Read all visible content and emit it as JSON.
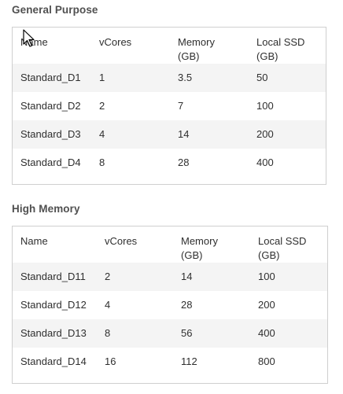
{
  "sections": [
    {
      "title": "General Purpose",
      "headers": [
        {
          "line1": "Name",
          "line2": ""
        },
        {
          "line1": "vCores",
          "line2": ""
        },
        {
          "line1": "Memory",
          "line2": "(GB)"
        },
        {
          "line1": "Local SSD",
          "line2": "(GB)"
        }
      ],
      "rows": [
        [
          "Standard_D1",
          "1",
          "3.5",
          "50"
        ],
        [
          "Standard_D2",
          "2",
          "7",
          "100"
        ],
        [
          "Standard_D3",
          "4",
          "14",
          "200"
        ],
        [
          "Standard_D4",
          "8",
          "28",
          "400"
        ]
      ]
    },
    {
      "title": "High Memory",
      "headers": [
        {
          "line1": "Name",
          "line2": ""
        },
        {
          "line1": "vCores",
          "line2": ""
        },
        {
          "line1": "Memory",
          "line2": "(GB)"
        },
        {
          "line1": "Local SSD",
          "line2": "(GB)"
        }
      ],
      "rows": [
        [
          "Standard_D11",
          "2",
          "14",
          "100"
        ],
        [
          "Standard_D12",
          "4",
          "28",
          "200"
        ],
        [
          "Standard_D13",
          "8",
          "56",
          "400"
        ],
        [
          "Standard_D14",
          "16",
          "112",
          "800"
        ]
      ]
    }
  ],
  "icons": {
    "cursor": "mouse-pointer-icon"
  }
}
